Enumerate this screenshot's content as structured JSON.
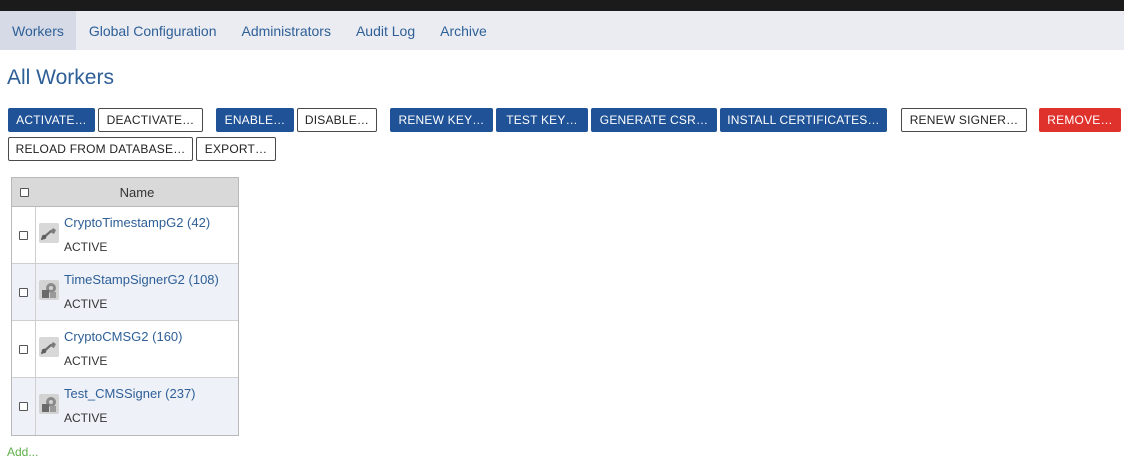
{
  "nav": {
    "tabs": [
      {
        "label": "Workers",
        "active": true
      },
      {
        "label": "Global Configuration",
        "active": false
      },
      {
        "label": "Administrators",
        "active": false
      },
      {
        "label": "Audit Log",
        "active": false
      },
      {
        "label": "Archive",
        "active": false
      }
    ]
  },
  "page": {
    "title": "All Workers"
  },
  "actions": {
    "activate": "ACTIVATE…",
    "deactivate": "DEACTIVATE…",
    "enable": "ENABLE…",
    "disable": "DISABLE…",
    "renew_key": "RENEW KEY…",
    "test_key": "TEST KEY…",
    "generate_csr": "GENERATE CSR…",
    "install_certificates": "INSTALL CERTIFICATES…",
    "renew_signer": "RENEW SIGNER…",
    "remove": "REMOVE…",
    "reload": "RELOAD FROM DATABASE…",
    "export": "EXPORT…"
  },
  "table": {
    "column_name": "Name",
    "rows": [
      {
        "name": "CryptoTimestampG2 (42)",
        "status": "ACTIVE",
        "icon": "crypto-key-icon"
      },
      {
        "name": "TimeStampSignerG2 (108)",
        "status": "ACTIVE",
        "icon": "signer-gear-icon"
      },
      {
        "name": "CryptoCMSG2 (160)",
        "status": "ACTIVE",
        "icon": "crypto-key-icon"
      },
      {
        "name": "Test_CMSSigner (237)",
        "status": "ACTIVE",
        "icon": "signer-gear-icon"
      }
    ]
  },
  "footer": {
    "add_label": "Add..."
  },
  "colors": {
    "primary": "#1f5296",
    "danger": "#e0322c",
    "link": "#2e5f97",
    "add_link": "#5fb04a"
  }
}
